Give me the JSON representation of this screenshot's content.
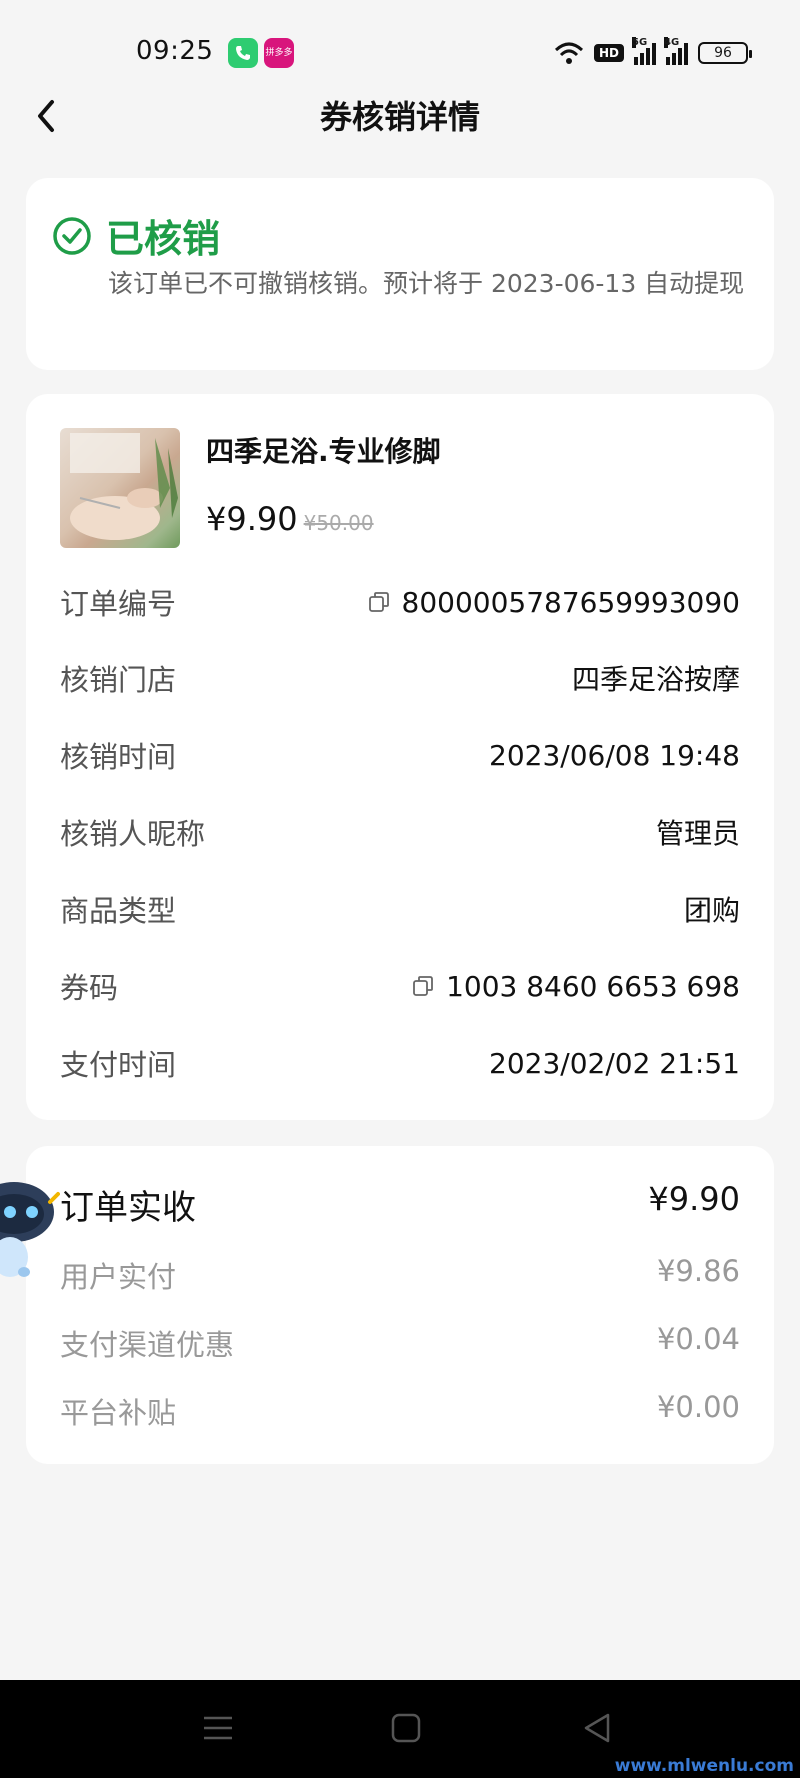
{
  "status_bar": {
    "time": "09:25",
    "pink_app_label": "拼多多",
    "hd_label": "HD",
    "net1": "5G",
    "net2": "4G",
    "battery": "96"
  },
  "header": {
    "title": "券核销详情",
    "back_icon": "chevron-left-icon"
  },
  "status_card": {
    "status": "已核销",
    "description": "该订单已不可撤销核销。预计将于 2023-06-13 自动提现",
    "accent_color": "#1f9d48"
  },
  "product": {
    "name": "四季足浴.专业修脚",
    "price": "¥9.90",
    "original_price": "¥50.00"
  },
  "details": [
    {
      "label": "订单编号",
      "value": "800000578765999​3090",
      "copyable": true
    },
    {
      "label": "核销门店",
      "value": "四季足浴按摩",
      "copyable": false
    },
    {
      "label": "核销时间",
      "value": "2023/06/08 19:48",
      "copyable": false
    },
    {
      "label": "核销人昵称",
      "value": "管理员",
      "copyable": false
    },
    {
      "label": "商品类型",
      "value": "团购",
      "copyable": false
    },
    {
      "label": "券码",
      "value": "1003 8460 6653 698",
      "copyable": true
    },
    {
      "label": "支付时间",
      "value": "2023/02/02 21:51",
      "copyable": false
    }
  ],
  "summary": {
    "title": "订单实收",
    "total": "¥9.90",
    "rows": [
      {
        "label": "用户实付",
        "value": "¥9.86"
      },
      {
        "label": "支付渠道优惠",
        "value": "¥0.04"
      },
      {
        "label": "平台补贴",
        "value": "¥0.00"
      }
    ]
  },
  "watermark": "www.mlwenlu.com"
}
